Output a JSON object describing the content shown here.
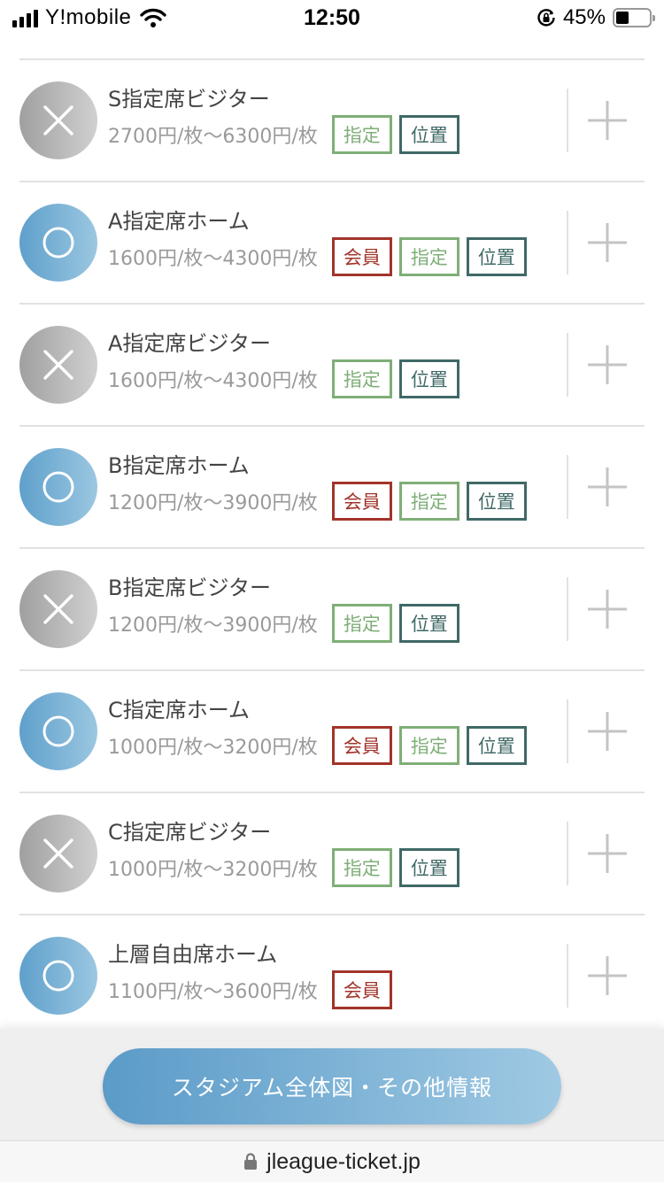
{
  "status_bar": {
    "carrier": "Y!mobile",
    "time": "12:50",
    "battery_percent": "45%",
    "battery_level": 0.45
  },
  "tag_labels": {
    "member": "会員",
    "reserved": "指定",
    "location": "位置"
  },
  "seats": [
    {
      "name": "S指定席ビジター",
      "price": "2700円/枚〜6300円/枚",
      "available": false,
      "tags": [
        "指定",
        "位置"
      ]
    },
    {
      "name": "A指定席ホーム",
      "price": "1600円/枚〜4300円/枚",
      "available": true,
      "tags": [
        "会員",
        "指定",
        "位置"
      ]
    },
    {
      "name": "A指定席ビジター",
      "price": "1600円/枚〜4300円/枚",
      "available": false,
      "tags": [
        "指定",
        "位置"
      ]
    },
    {
      "name": "B指定席ホーム",
      "price": "1200円/枚〜3900円/枚",
      "available": true,
      "tags": [
        "会員",
        "指定",
        "位置"
      ]
    },
    {
      "name": "B指定席ビジター",
      "price": "1200円/枚〜3900円/枚",
      "available": false,
      "tags": [
        "指定",
        "位置"
      ]
    },
    {
      "name": "C指定席ホーム",
      "price": "1000円/枚〜3200円/枚",
      "available": true,
      "tags": [
        "会員",
        "指定",
        "位置"
      ]
    },
    {
      "name": "C指定席ビジター",
      "price": "1000円/枚〜3200円/枚",
      "available": false,
      "tags": [
        "指定",
        "位置"
      ]
    },
    {
      "name": "上層自由席ホーム",
      "price": "1100円/枚〜3600円/枚",
      "available": true,
      "tags": [
        "会員"
      ]
    }
  ],
  "cta": {
    "label": "スタジアム全体図・その他情報"
  },
  "browser": {
    "url": "jleague-ticket.jp"
  },
  "colors": {
    "available_gradient": [
      "#5fa0cb",
      "#9bc7e1"
    ],
    "unavailable_gradient": [
      "#a0a0a0",
      "#d0d0d0"
    ],
    "member_tag": "#a2342a",
    "reserved_tag": "#7fae78",
    "location_tag": "#3f6966"
  }
}
